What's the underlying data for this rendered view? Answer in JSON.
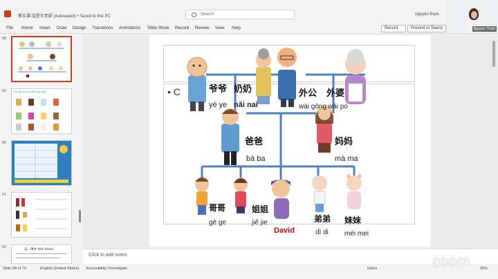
{
  "titlebar": {
    "doc_title": "第五课 這是王老師 (Autosaved) • Saved to this PC",
    "search_placeholder": "Search",
    "user_name": "nguyen tham"
  },
  "webcam": {
    "label": "Nguyen Tham"
  },
  "menu": {
    "items": [
      "File",
      "Home",
      "Insert",
      "Draw",
      "Design",
      "Transitions",
      "Animations",
      "Slide Show",
      "Record",
      "Review",
      "View",
      "Help"
    ],
    "record_label": "Record",
    "present_label": "Present in Teams"
  },
  "sidebar": {
    "slides": [
      {
        "num": "58",
        "active": true
      },
      {
        "num": "59",
        "active": false
      },
      {
        "num": "60",
        "active": false
      },
      {
        "num": "61",
        "active": false
      },
      {
        "num": "62",
        "active": false
      }
    ],
    "slide59_title": "Các loại đồ uống thường dùng",
    "slide62_title": "五、填文 (Bài khóa)"
  },
  "slide": {
    "bullet": "• C",
    "family": [
      {
        "hanzi": "爷爷",
        "pinyin": "yé ye"
      },
      {
        "hanzi": "奶奶",
        "pinyin": "nǎi nai"
      },
      {
        "hanzi": "外公",
        "pinyin": "wài gōng"
      },
      {
        "hanzi": "外婆",
        "pinyin": "wài pó"
      },
      {
        "hanzi": "爸爸",
        "pinyin": "bà ba"
      },
      {
        "hanzi": "妈妈",
        "pinyin": "mà ma"
      },
      {
        "hanzi": "哥哥",
        "pinyin": "gē ge"
      },
      {
        "hanzi": "姐姐",
        "pinyin": "jiě jie"
      },
      {
        "hanzi": "David",
        "pinyin": ""
      },
      {
        "hanzi": "弟弟",
        "pinyin": "dì di"
      },
      {
        "hanzi": "妹妹",
        "pinyin": "mèi mei"
      }
    ],
    "colors": {
      "tree_line": "#4f81bd",
      "david": "#c00000"
    }
  },
  "notes": {
    "placeholder": "Click to add notes"
  },
  "status": {
    "slide_info": "Slide 58 of 73",
    "language": "English (United States)",
    "accessibility": "Accessibility: Investigate",
    "notes": "Notes",
    "zoom": "90%"
  },
  "zoom_logo": "zoom"
}
